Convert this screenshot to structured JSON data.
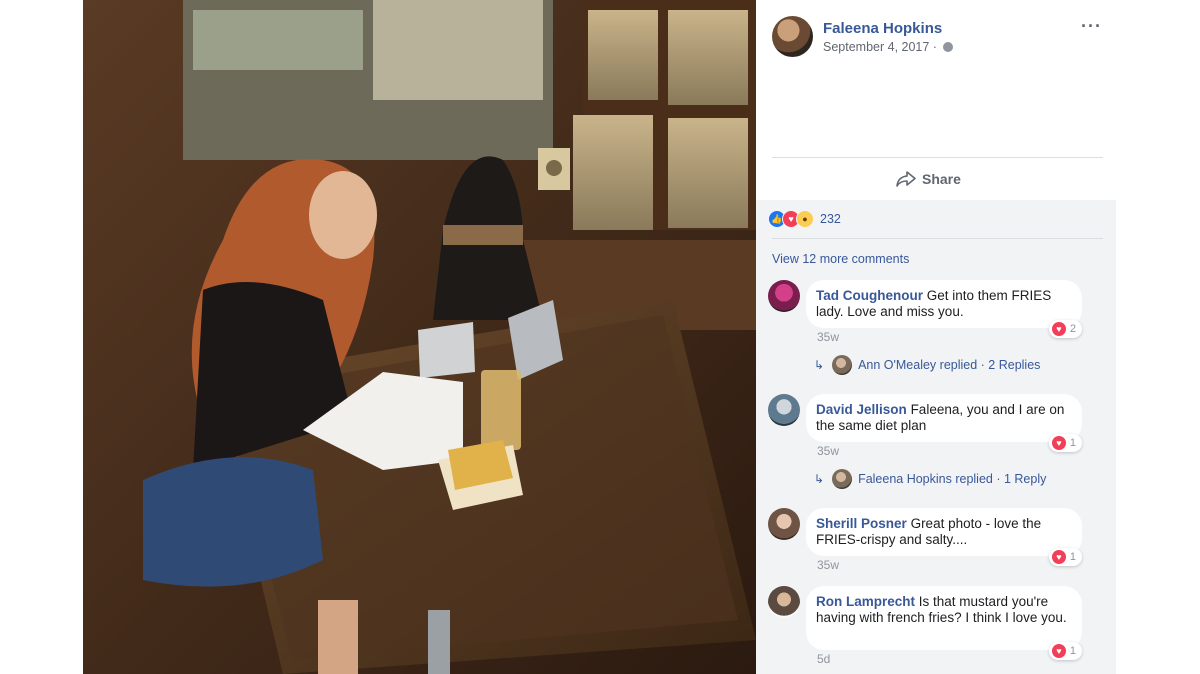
{
  "post": {
    "author": "Faleena Hopkins",
    "date": "September 4, 2017 ·",
    "privacy_icon": "globe-icon",
    "more_icon": "ellipsis-icon",
    "share_label": "Share"
  },
  "reactions": {
    "icons": [
      "like-icon",
      "love-icon",
      "wow-icon"
    ],
    "count": "232"
  },
  "view_more": "View 12 more comments",
  "comments": [
    {
      "name": "Tad Coughenour",
      "text": "Get into them FRIES lady. Love and miss you.",
      "time": "35w",
      "loves": "2",
      "reply": {
        "text": "Ann O'Mealey replied · 2 Replies"
      }
    },
    {
      "name": "David Jellison",
      "text": "Faleena, you and I are on the same diet plan",
      "time": "35w",
      "loves": "1",
      "reply": {
        "text": "Faleena Hopkins replied · 1 Reply"
      }
    },
    {
      "name": "Sherill Posner",
      "text": "Great photo - love the FRIES-crispy and salty....",
      "time": "35w",
      "loves": "1"
    },
    {
      "name": "Ron Lamprecht",
      "text": "Is that mustard you're having with french fries? I think I love you.",
      "time": "5d",
      "loves": "1"
    }
  ],
  "colors": {
    "link": "#385898",
    "love": "#f33e58",
    "like": "#1877f2",
    "comment_area": "#f2f3f5"
  }
}
